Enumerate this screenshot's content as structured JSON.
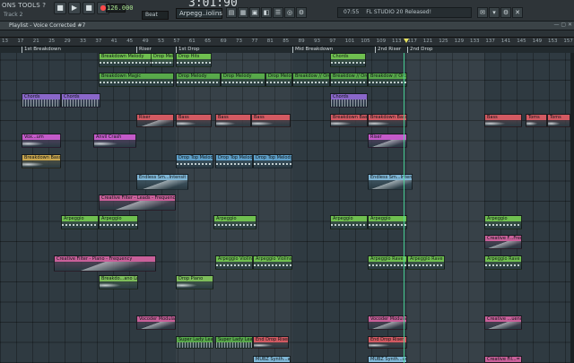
{
  "toolbar": {
    "menu_text": "ONS  TOOLS  ?",
    "track_hint": "Track 2",
    "tempo": "126.000",
    "time_display": "3:01:90",
    "snap_label": "Beat",
    "pattern_name": "Arpegg..iolins",
    "news_text": "FL STUDIO 20 Released!",
    "news_counter": "07:55",
    "transport": [
      "■",
      "▶",
      "■",
      "●",
      "⟲"
    ],
    "tool_icons": [
      "▤",
      "▦",
      "▣",
      "◧",
      "☰",
      "◎",
      "⚙"
    ],
    "right_icons": [
      "✉",
      "▾",
      "⚙",
      "✕"
    ]
  },
  "playlist": {
    "title": "Playlist - Voice Corrected #7",
    "win_controls": "— ▢ ✕",
    "ruler": [
      "13",
      "17",
      "21",
      "25",
      "29",
      "33",
      "37",
      "41",
      "45",
      "49",
      "53",
      "57",
      "61",
      "65",
      "69",
      "73",
      "77",
      "81",
      "85",
      "89",
      "93",
      "97",
      "101",
      "105",
      "109",
      "113",
      "117",
      "121",
      "125",
      "129",
      "133",
      "137",
      "141",
      "145",
      "149",
      "153",
      "157"
    ],
    "markers": [
      {
        "label": "1st Breakdown"
      },
      {
        "label": "Riser"
      },
      {
        "label": "1st Drop"
      },
      {
        "label": "Mid Breakdown"
      },
      {
        "label": "2nd Riser"
      },
      {
        "label": "2nd Drop"
      }
    ],
    "clips": [
      {
        "label": "Breakdown Melody",
        "color": "#6fbf4f"
      },
      {
        "label": "Drop Melody",
        "color": "#6fbf4f"
      },
      {
        "label": "Drop Hits",
        "color": "#6fbf4f"
      },
      {
        "label": "Chords",
        "color": "#6fbf4f"
      },
      {
        "label": "Breakdown Magic",
        "color": "#58a94a"
      },
      {
        "label": "Drop Melody",
        "color": "#58a94a"
      },
      {
        "label": "Drop Melody",
        "color": "#58a94a"
      },
      {
        "label": "Drop Melody",
        "color": "#58a94a"
      },
      {
        "label": "Breakdow // Orche",
        "color": "#58a94a"
      },
      {
        "label": "Breakdow // Orche",
        "color": "#58a94a"
      },
      {
        "label": "Breakdow // Orche",
        "color": "#58a94a"
      },
      {
        "label": "Chords",
        "color": "#8a67c9"
      },
      {
        "label": "Chords",
        "color": "#8a67c9"
      },
      {
        "label": "Chords",
        "color": "#8a67c9"
      },
      {
        "label": "Riser",
        "color": "#d35a62"
      },
      {
        "label": "Bass",
        "color": "#d35a62"
      },
      {
        "label": "Bass",
        "color": "#d35a62"
      },
      {
        "label": "Bass",
        "color": "#d35a62"
      },
      {
        "label": "Breakdown Bass",
        "color": "#d35a62"
      },
      {
        "label": "Breakdown Bass",
        "color": "#d35a62"
      },
      {
        "label": "Bass",
        "color": "#d35a62"
      },
      {
        "label": "Toms",
        "color": "#d35a62"
      },
      {
        "label": "Toms",
        "color": "#d35a62"
      },
      {
        "label": "Vox...um",
        "color": "#c45ac9"
      },
      {
        "label": "Anvil Crash",
        "color": "#c45ac9"
      },
      {
        "label": "Riser",
        "color": "#c45ac9"
      },
      {
        "label": "Breakdown Bass",
        "color": "#c9a64f"
      },
      {
        "label": "Drop Top Melody",
        "color": "#5fa0c9"
      },
      {
        "label": "Drop Top Melody",
        "color": "#5fa0c9"
      },
      {
        "label": "Drop Top Melody",
        "color": "#5fa0c9"
      },
      {
        "label": "Endless Sm...Intensit",
        "color": "#7fb6d6"
      },
      {
        "label": "Endless Sm...Intensit",
        "color": "#7fb6d6"
      },
      {
        "label": "Creative Filter - Leads - Frequency",
        "color": "#c9609a"
      },
      {
        "label": "Arpeggio",
        "color": "#6fbf4f"
      },
      {
        "label": "Arpeggio",
        "color": "#6fbf4f"
      },
      {
        "label": "Arpeggio",
        "color": "#6fbf4f"
      },
      {
        "label": "Arpeggio",
        "color": "#6fbf4f"
      },
      {
        "label": "Arpeggio",
        "color": "#6fbf4f"
      },
      {
        "label": "Arpeggio",
        "color": "#6fbf4f"
      },
      {
        "label": "Creative Filter - Piano - Frequency",
        "color": "#c9609a"
      },
      {
        "label": "Arpeggio Violins",
        "color": "#6fbf4f"
      },
      {
        "label": "Arpeggio Violins",
        "color": "#6fbf4f"
      },
      {
        "label": "Arpeggio Rave",
        "color": "#6fbf4f"
      },
      {
        "label": "Arpeggio Rave",
        "color": "#6fbf4f"
      },
      {
        "label": "Arpeggio Rave",
        "color": "#6fbf4f"
      },
      {
        "label": "Drop Piano",
        "color": "#7dbd5a"
      },
      {
        "label": "Breakdo...ano Low",
        "color": "#7dbd5a"
      },
      {
        "label": "Creative F...Frequency",
        "color": "#c9609a"
      },
      {
        "label": "Vocoder Modulation",
        "color": "#c9609a"
      },
      {
        "label": "Vocoder Modulation",
        "color": "#c9609a"
      },
      {
        "label": "Creative ...uency X2",
        "color": "#c9609a"
      },
      {
        "label": "Super Lady Lead",
        "color": "#58a94a"
      },
      {
        "label": "Super Lady Lead",
        "color": "#58a94a"
      },
      {
        "label": "End Drop Riser",
        "color": "#d35a62"
      },
      {
        "label": "End Drop Riser",
        "color": "#d35a62"
      },
      {
        "label": "MUBZ Synth...amel pitch",
        "color": "#7fb6d6"
      },
      {
        "label": "MUBZ Synth...amel pitch",
        "color": "#7fb6d6"
      },
      {
        "label": "Creative Fil...= Frequency",
        "color": "#c9609a"
      }
    ]
  }
}
